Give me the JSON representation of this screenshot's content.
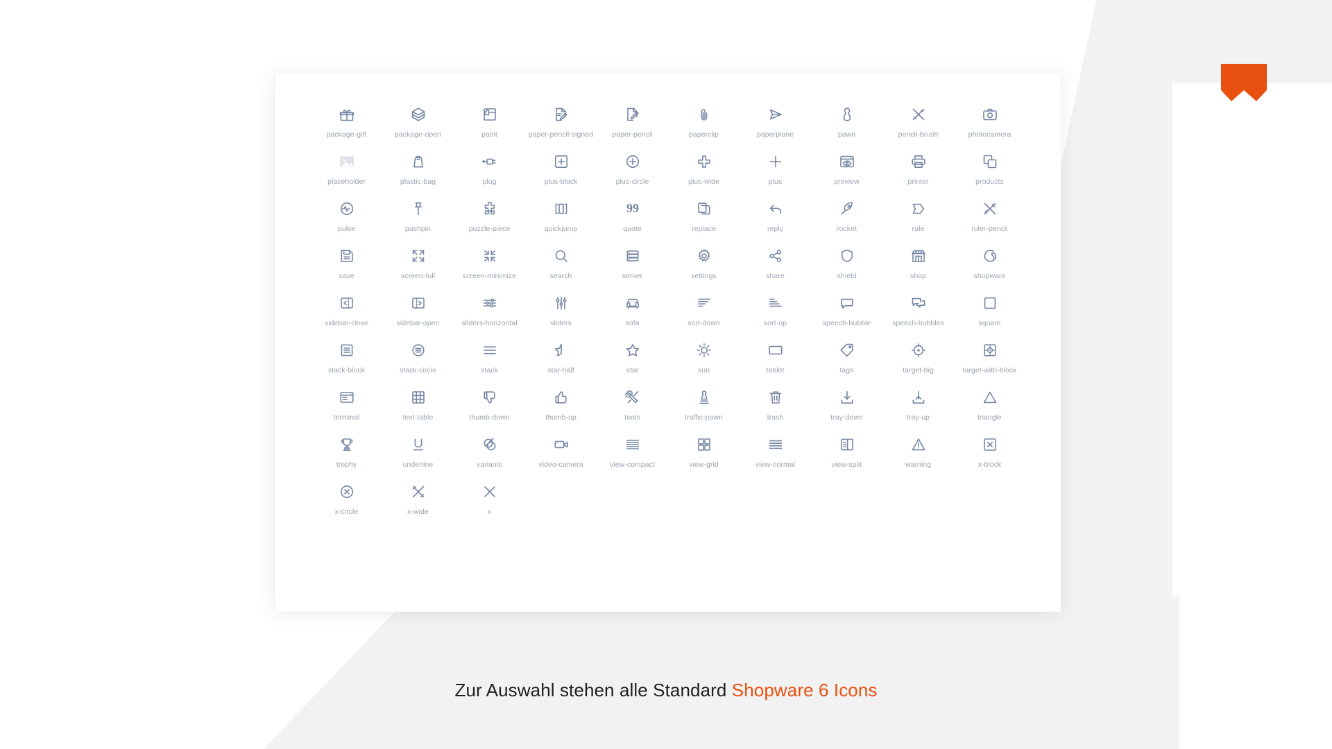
{
  "page": {
    "background_color": "#ffffff",
    "card_background": "#ffffff",
    "icon_color": "#7486a3",
    "label_color": "#9aa4b0",
    "accent_color": "#e8500f",
    "ribbon_color": "#f2f2f2"
  },
  "logo": {
    "name": "shopware-logo",
    "color": "#e8500f"
  },
  "caption": {
    "text_plain": "Zur Auswahl stehen alle Standard ",
    "text_accent": "Shopware 6 Icons"
  },
  "grid": {
    "columns": 10,
    "icons": [
      {
        "label": "package-gift",
        "icon": "package-gift-icon"
      },
      {
        "label": "package-open",
        "icon": "package-open-icon"
      },
      {
        "label": "paint",
        "icon": "paint-icon"
      },
      {
        "label": "paper-pencil-signed",
        "icon": "paper-pencil-signed-icon"
      },
      {
        "label": "paper-pencil",
        "icon": "paper-pencil-icon"
      },
      {
        "label": "paperclip",
        "icon": "paperclip-icon"
      },
      {
        "label": "paperplane",
        "icon": "paperplane-icon"
      },
      {
        "label": "pawn",
        "icon": "pawn-icon"
      },
      {
        "label": "pencil-brush",
        "icon": "pencil-brush-icon"
      },
      {
        "label": "photocamera",
        "icon": "photocamera-icon"
      },
      {
        "label": "placeholder",
        "icon": "placeholder-icon"
      },
      {
        "label": "plastic-bag",
        "icon": "plastic-bag-icon"
      },
      {
        "label": "plug",
        "icon": "plug-icon"
      },
      {
        "label": "plus-block",
        "icon": "plus-block-icon"
      },
      {
        "label": "plus-circle",
        "icon": "plus-circle-icon"
      },
      {
        "label": "plus-wide",
        "icon": "plus-wide-icon"
      },
      {
        "label": "plus",
        "icon": "plus-icon"
      },
      {
        "label": "preview",
        "icon": "preview-icon"
      },
      {
        "label": "printer",
        "icon": "printer-icon"
      },
      {
        "label": "products",
        "icon": "products-icon"
      },
      {
        "label": "pulse",
        "icon": "pulse-icon"
      },
      {
        "label": "pushpin",
        "icon": "pushpin-icon"
      },
      {
        "label": "puzzle-piece",
        "icon": "puzzle-piece-icon"
      },
      {
        "label": "quickjump",
        "icon": "quickjump-icon"
      },
      {
        "label": "quote",
        "icon": "quote-icon"
      },
      {
        "label": "replace",
        "icon": "replace-icon"
      },
      {
        "label": "reply",
        "icon": "reply-icon"
      },
      {
        "label": "rocket",
        "icon": "rocket-icon"
      },
      {
        "label": "rule",
        "icon": "rule-icon"
      },
      {
        "label": "ruler-pencil",
        "icon": "ruler-pencil-icon"
      },
      {
        "label": "save",
        "icon": "save-icon"
      },
      {
        "label": "screen-full",
        "icon": "screen-full-icon"
      },
      {
        "label": "screen-minimize",
        "icon": "screen-minimize-icon"
      },
      {
        "label": "search",
        "icon": "search-icon"
      },
      {
        "label": "server",
        "icon": "server-icon"
      },
      {
        "label": "settings",
        "icon": "settings-icon"
      },
      {
        "label": "share",
        "icon": "share-icon"
      },
      {
        "label": "shield",
        "icon": "shield-icon"
      },
      {
        "label": "shop",
        "icon": "shop-icon"
      },
      {
        "label": "shopware",
        "icon": "shopware-icon"
      },
      {
        "label": "sidebar-close",
        "icon": "sidebar-close-icon"
      },
      {
        "label": "sidebar-open",
        "icon": "sidebar-open-icon"
      },
      {
        "label": "sliders-horizontal",
        "icon": "sliders-horizontal-icon"
      },
      {
        "label": "sliders",
        "icon": "sliders-icon"
      },
      {
        "label": "sofa",
        "icon": "sofa-icon"
      },
      {
        "label": "sort-down",
        "icon": "sort-down-icon"
      },
      {
        "label": "sort-up",
        "icon": "sort-up-icon"
      },
      {
        "label": "speech-bubble",
        "icon": "speech-bubble-icon"
      },
      {
        "label": "speech-bubbles",
        "icon": "speech-bubbles-icon"
      },
      {
        "label": "square",
        "icon": "square-icon"
      },
      {
        "label": "stack-block",
        "icon": "stack-block-icon"
      },
      {
        "label": "stack-circle",
        "icon": "stack-circle-icon"
      },
      {
        "label": "stack",
        "icon": "stack-icon"
      },
      {
        "label": "star-half",
        "icon": "star-half-icon"
      },
      {
        "label": "star",
        "icon": "star-icon"
      },
      {
        "label": "sun",
        "icon": "sun-icon"
      },
      {
        "label": "tablet",
        "icon": "tablet-icon"
      },
      {
        "label": "tags",
        "icon": "tags-icon"
      },
      {
        "label": "target-big",
        "icon": "target-big-icon"
      },
      {
        "label": "target-with-block",
        "icon": "target-with-block-icon"
      },
      {
        "label": "terminal",
        "icon": "terminal-icon"
      },
      {
        "label": "text-table",
        "icon": "text-table-icon"
      },
      {
        "label": "thumb-down",
        "icon": "thumb-down-icon"
      },
      {
        "label": "thumb-up",
        "icon": "thumb-up-icon"
      },
      {
        "label": "tools",
        "icon": "tools-icon"
      },
      {
        "label": "traffic-pawn",
        "icon": "traffic-pawn-icon"
      },
      {
        "label": "trash",
        "icon": "trash-icon"
      },
      {
        "label": "tray-down",
        "icon": "tray-down-icon"
      },
      {
        "label": "tray-up",
        "icon": "tray-up-icon"
      },
      {
        "label": "triangle",
        "icon": "triangle-icon"
      },
      {
        "label": "trophy",
        "icon": "trophy-icon"
      },
      {
        "label": "underline",
        "icon": "underline-icon"
      },
      {
        "label": "variants",
        "icon": "variants-icon"
      },
      {
        "label": "video-camera",
        "icon": "video-camera-icon"
      },
      {
        "label": "view-compact",
        "icon": "view-compact-icon"
      },
      {
        "label": "view-grid",
        "icon": "view-grid-icon"
      },
      {
        "label": "view-normal",
        "icon": "view-normal-icon"
      },
      {
        "label": "view-split",
        "icon": "view-split-icon"
      },
      {
        "label": "warning",
        "icon": "warning-icon"
      },
      {
        "label": "x-block",
        "icon": "x-block-icon"
      },
      {
        "label": "x-circle",
        "icon": "x-circle-icon"
      },
      {
        "label": "x-wide",
        "icon": "x-wide-icon"
      },
      {
        "label": "x",
        "icon": "x-icon"
      }
    ]
  }
}
